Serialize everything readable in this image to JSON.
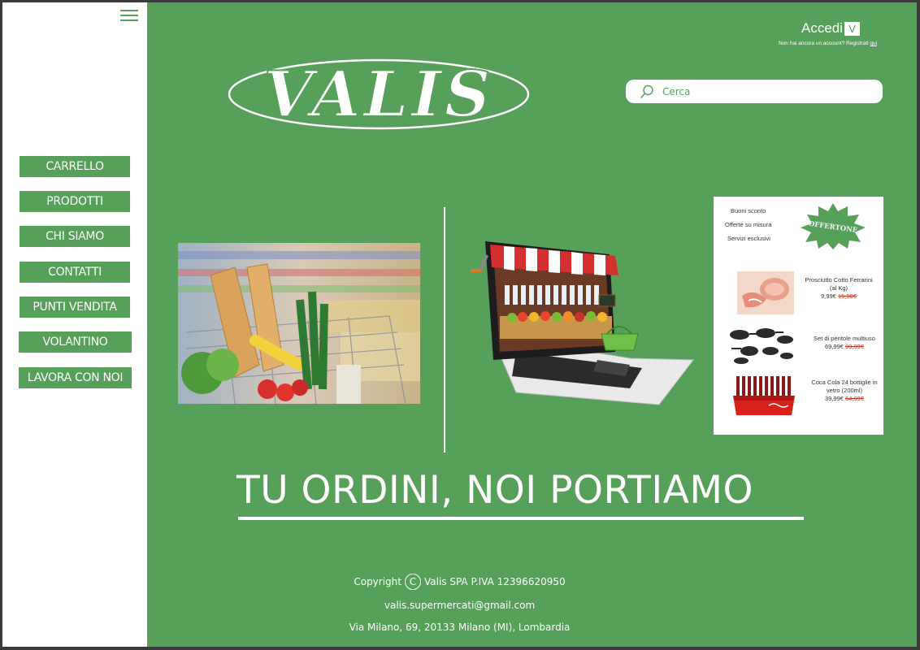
{
  "colors": {
    "brand_green": "#56a05a",
    "white": "#ffffff",
    "price_strike": "#c0392b"
  },
  "sidebar": {
    "menu_icon": "hamburger-icon",
    "items": [
      {
        "label": "CARRELLO"
      },
      {
        "label": "PRODOTTI"
      },
      {
        "label": "CHI SIAMO"
      },
      {
        "label": "CONTATTI"
      },
      {
        "label": "PUNTI VENDITA"
      },
      {
        "label": "VOLANTINO"
      },
      {
        "label": "LAVORA CON NOI"
      }
    ]
  },
  "header": {
    "logo_text": "VALIS",
    "login_label": "Accedi",
    "login_chevron": "V",
    "register_prompt": "Non hai ancora un account? Registrati",
    "register_link": "qui"
  },
  "search": {
    "placeholder": "Cerca",
    "icon": "search-icon"
  },
  "promo": {
    "links": [
      "Buoni sconto",
      "Offerte su misura",
      "Servizi esclusivi"
    ],
    "badge": "OFFERTONE",
    "items": [
      {
        "name": "Prosciutto Cotto Ferrarini (al Kg)",
        "price": "9,99€",
        "old_price": "15,98€"
      },
      {
        "name": "Set di pentole multiuso",
        "price": "69,99€",
        "old_price": "99,99€"
      },
      {
        "name": "Coca Cola 24 bottiglie in vetro (200ml)",
        "price": "39,99€",
        "old_price": "64,99€"
      }
    ]
  },
  "hero": {
    "tagline": "TU ORDINI, NOI PORTIAMO"
  },
  "footer": {
    "copyright_label": "Copyright",
    "company": "Valis SPA P.IVA 12396620950",
    "email": "valis.supermercati@gmail.com",
    "address": "Via Milano, 69, 20133 Milano (MI), Lombardia"
  }
}
